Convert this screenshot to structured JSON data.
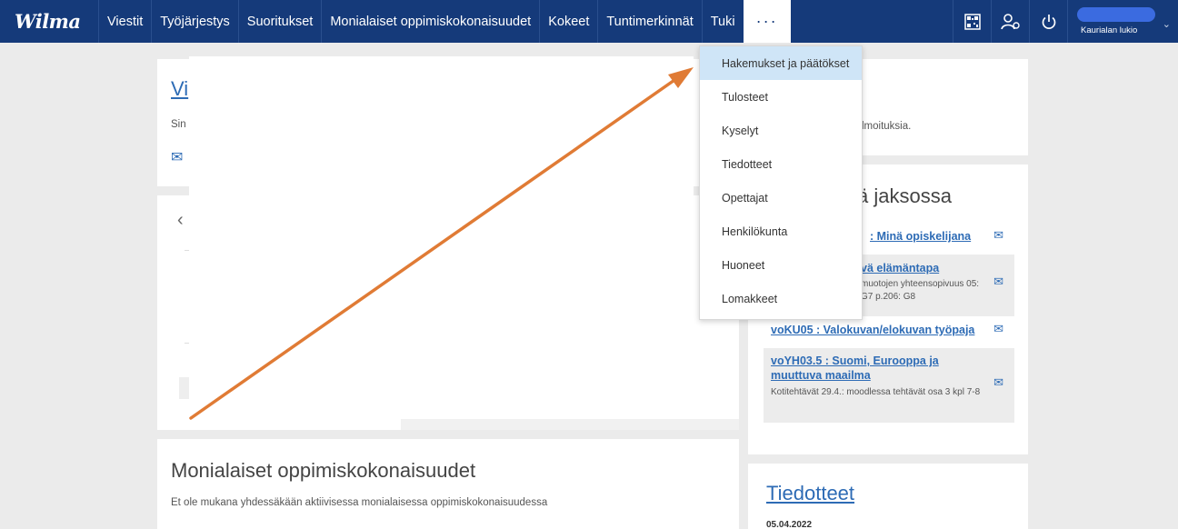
{
  "topbar": {
    "logo": "Wilma",
    "nav": [
      "Viestit",
      "Työjärjestys",
      "Suoritukset",
      "Monialaiset oppimiskokonaisuudet",
      "Kokeet",
      "Tuntimerkinnät",
      "Tuki"
    ],
    "more_label": "···",
    "user_school": "Kaurialan lukio"
  },
  "dropdown": {
    "items": [
      "Hakemukset ja päätökset",
      "Tulosteet",
      "Kyselyt",
      "Tiedotteet",
      "Opettajat",
      "Henkilökunta",
      "Huoneet",
      "Lomakkeet"
    ]
  },
  "left_panel": {
    "title_fragment": "Vi",
    "text_fragment": "Sin",
    "chevron": "‹"
  },
  "right_top": {
    "text_fragment": "lmoituksia."
  },
  "courses_panel": {
    "title_fragment": "sä jaksossa",
    "courses": [
      {
        "title": ": Minä opiskelijana",
        "note": ""
      },
      {
        "title": "vä elämäntapa",
        "note": "muotojen yhteensopivuus 05: G7 p.206: G8"
      },
      {
        "title": "voKU05 : Valokuvan/elokuvan työpaja",
        "note": ""
      },
      {
        "title": "voYH03.5 : Suomi, Eurooppa ja muuttuva maailma",
        "note": "Kotitehtävät 29.4.: moodlessa tehtävät osa 3 kpl 7-8"
      }
    ]
  },
  "monialaiset": {
    "title": "Monialaiset oppimiskokonaisuudet",
    "text": "Et ole mukana yhdessäkään aktiivisessa monialaisessa oppimiskokonaisuudessa"
  },
  "tiedotteet": {
    "title": "Tiedotteet",
    "date": "05.04.2022"
  },
  "colors": {
    "topbar": "#153a7a",
    "link": "#2d6bb5",
    "arrow": "#e07b35",
    "dropdown_active": "#cfe5f7"
  }
}
